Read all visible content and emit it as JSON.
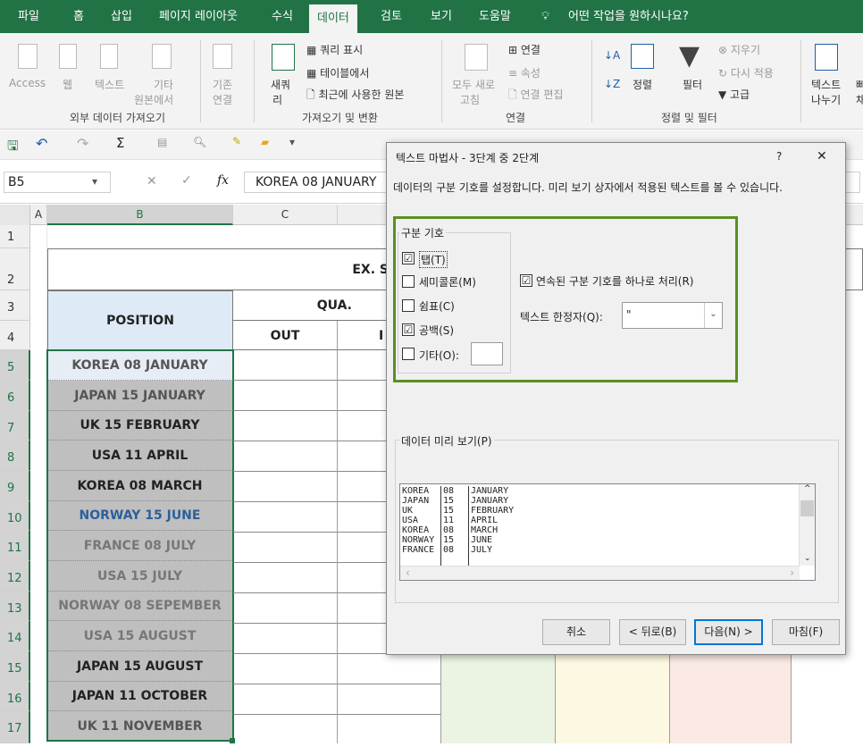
{
  "menu": {
    "tabs": [
      "파일",
      "홈",
      "삽입",
      "페이지 레이아웃",
      "수식",
      "데이터",
      "검토",
      "보기",
      "도움말"
    ],
    "tell_me": "어떤 작업을 원하시나요?"
  },
  "ribbon": {
    "access": "Access",
    "web": "웹",
    "text": "텍스트",
    "other1": "기타",
    "other2": "원본에서",
    "existing1": "기존",
    "existing2": "연결",
    "group_external": "외부 데이터 가져오기",
    "new_query1": "새쿼",
    "new_query2": "리",
    "show_query": "쿼리 표시",
    "from_table": "테이블에서",
    "recent": "최근에 사용한 원본",
    "group_transform": "가져오기 및 변환",
    "refresh1": "모두 새로",
    "refresh2": "고침",
    "connections": "연결",
    "properties": "속성",
    "edit_links": "연결 편집",
    "group_connections": "연결",
    "sort": "정렬",
    "filter": "필터",
    "clear": "지우기",
    "reapply": "다시 적용",
    "advanced": "고급",
    "group_sort": "정렬 및 필터",
    "text_to_cols1": "텍스트",
    "text_to_cols2": "나누기",
    "extra1": "빠",
    "extra2": "채"
  },
  "formula_bar": {
    "name_box": "B5",
    "content": "KOREA 08 JANUARY"
  },
  "columns": [
    "A",
    "B",
    "C"
  ],
  "rows": [
    {
      "num": "1"
    },
    {
      "num": "2"
    },
    {
      "num": "3"
    },
    {
      "num": "4"
    },
    {
      "num": "5"
    },
    {
      "num": "6"
    },
    {
      "num": "7"
    },
    {
      "num": "8"
    },
    {
      "num": "9"
    },
    {
      "num": "10"
    },
    {
      "num": "11"
    },
    {
      "num": "12"
    },
    {
      "num": "13"
    },
    {
      "num": "14"
    },
    {
      "num": "15"
    },
    {
      "num": "16"
    },
    {
      "num": "17"
    }
  ],
  "sheet": {
    "header_ex": "EX. S",
    "position": "POSITION",
    "qua": "QUA.",
    "out": "OUT",
    "in_partial": "I",
    "b_values": [
      "KOREA 08 JANUARY",
      "JAPAN 15 JANUARY",
      "UK 15 FEBRUARY",
      "USA 11 APRIL",
      "KOREA 08 MARCH",
      "NORWAY 15 JUNE",
      "FRANCE 08 JULY",
      "USA 15 JULY",
      "NORWAY 08 SEPEMBER",
      "USA 15 AUGUST",
      "JAPAN 15 AUGUST",
      "JAPAN 11 OCTOBER",
      "UK 11 NOVEMBER"
    ],
    "b_colors": [
      "#555555",
      "#555555",
      "#222222",
      "#222222",
      "#222222",
      "#2e5f9a",
      "#777777",
      "#777777",
      "#777777",
      "#777777",
      "#222222",
      "#222222",
      "#555555"
    ]
  },
  "dialog": {
    "title": "텍스트 마법사 - 3단계 중 2단계",
    "help": "?",
    "close": "✕",
    "description": "데이터의 구분 기호를 설정합니다. 미리 보기 상자에서 적용된 텍스트를 볼 수 있습니다.",
    "delimiters_label": "구분 기호",
    "tab_label": "탭(T)",
    "tab_checked": "☑",
    "semicolon_label": "세미콜론(M)",
    "comma_label": "쉼표(C)",
    "space_label": "공백(S)",
    "space_checked": "☑",
    "other_label": "기타(O):",
    "consecutive_label": "연속된 구분 기호를 하나로 처리(R)",
    "consecutive_checked": "☑",
    "qualifier_label": "텍스트 한정자(Q):",
    "qualifier_value": "\"",
    "preview_label": "데이터 미리 보기(P)",
    "preview_rows": [
      [
        "KOREA",
        "08",
        "JANUARY"
      ],
      [
        "JAPAN",
        "15",
        "JANUARY"
      ],
      [
        "UK",
        "15",
        "FEBRUARY"
      ],
      [
        "USA",
        "11",
        "APRIL"
      ],
      [
        "KOREA",
        "08",
        "MARCH"
      ],
      [
        "NORWAY",
        "15",
        "JUNE"
      ],
      [
        "FRANCE",
        "08",
        "JULY"
      ]
    ],
    "cancel": "취소",
    "back": "< 뒤로(B)",
    "next": "다음(N) >",
    "finish": "마침(F)"
  }
}
